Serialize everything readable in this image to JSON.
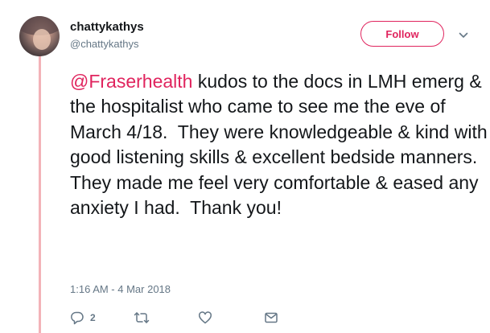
{
  "user": {
    "display_name": "chattykathys",
    "handle": "@chattykathys"
  },
  "follow_button": {
    "label": "Follow"
  },
  "tweet": {
    "mention": "@Fraserhealth",
    "text": " kudos to the docs in LMH emerg & the hospitalist who came to see me the eve of March 4/18.  They were knowledgeable & kind with good listening skills & excellent bedside manners.  They made me feel very comfortable & eased any anxiety I had.  Thank you!",
    "timestamp": "1:16 AM - 4 Mar 2018"
  },
  "actions": {
    "reply_count": "2"
  },
  "icons": {
    "reply": "reply-icon",
    "retweet": "retweet-icon",
    "like": "heart-icon",
    "direct_message": "envelope-icon",
    "more": "chevron-down-icon"
  },
  "colors": {
    "accent": "#e0245e",
    "thread_line": "#f3b3b8",
    "secondary_text": "#657786",
    "primary_text": "#14171a"
  }
}
